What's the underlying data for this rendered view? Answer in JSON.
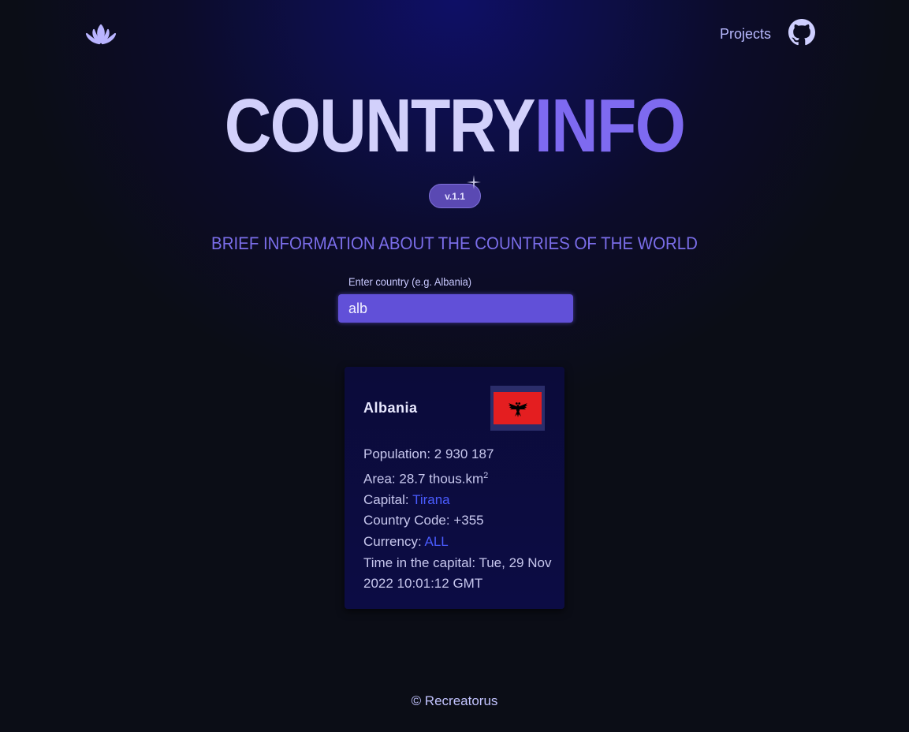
{
  "header": {
    "logo_icon": "lotus-icon",
    "nav_projects": "Projects",
    "github_icon": "github-icon"
  },
  "hero": {
    "title_part1": "COUNTRY",
    "title_part2": "INFO",
    "version": "v.1.1",
    "subtitle": "BRIEF INFORMATION ABOUT THE COUNTRIES OF THE WORLD"
  },
  "search": {
    "label": "Enter country (e.g. Albania)",
    "value": "alb"
  },
  "card": {
    "country": "Albania",
    "flag_icon": "albania-flag-icon",
    "population_label": "Population: ",
    "population_value": "2 930 187",
    "area_label": "Area: ",
    "area_value": "28.7 thous.km",
    "area_sup": "2",
    "capital_label": "Capital: ",
    "capital_value": "Tirana",
    "code_label": "Country Code: ",
    "code_value": "+355",
    "currency_label": "Currency: ",
    "currency_value": "ALL",
    "time_label": "Time in the capital: ",
    "time_value": "Tue, 29 Nov 2022 10:01:12 GMT"
  },
  "footer": {
    "text": "© Recreatorus"
  },
  "colors": {
    "accent": "#7e6af0",
    "input_bg": "#6150d8",
    "link": "#4a5cff",
    "flag_red": "#e41e20"
  }
}
